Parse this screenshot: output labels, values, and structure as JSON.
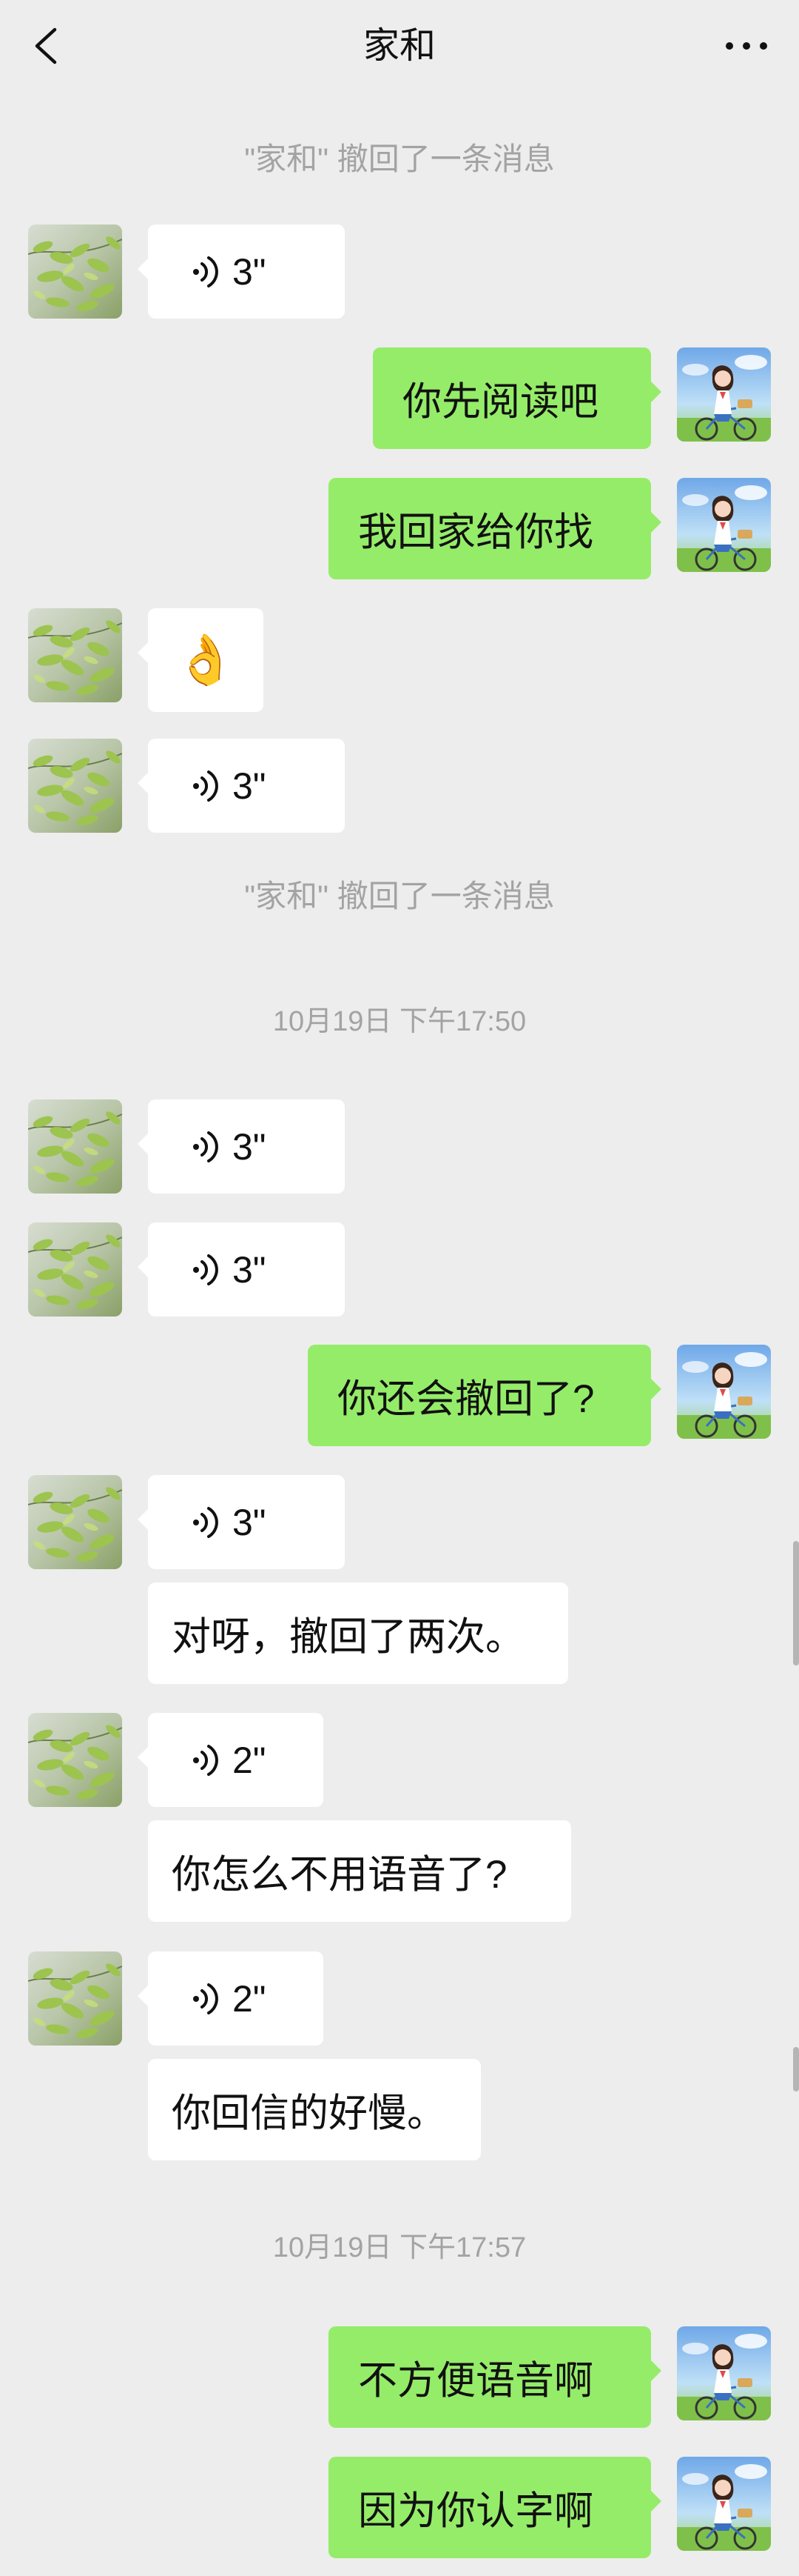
{
  "header": {
    "title": "家和"
  },
  "messages": [
    {
      "type": "system",
      "text": "\"家和\" 撤回了一条消息"
    },
    {
      "type": "voice",
      "from": "them",
      "duration": "3\""
    },
    {
      "type": "text",
      "from": "me",
      "text": "你先阅读吧"
    },
    {
      "type": "text",
      "from": "me",
      "text": "我回家给你找"
    },
    {
      "type": "emoji",
      "from": "them",
      "text": "👌"
    },
    {
      "type": "voice",
      "from": "them",
      "duration": "3\""
    },
    {
      "type": "system",
      "text": "\"家和\" 撤回了一条消息"
    },
    {
      "type": "timestamp",
      "text": "10月19日 下午17:50"
    },
    {
      "type": "voice",
      "from": "them",
      "duration": "3\""
    },
    {
      "type": "voice",
      "from": "them",
      "duration": "3\""
    },
    {
      "type": "text",
      "from": "me",
      "text": "你还会撤回了?"
    },
    {
      "type": "voice",
      "from": "them",
      "duration": "3\""
    },
    {
      "type": "text",
      "from": "them",
      "text": "对呀，撤回了两次。"
    },
    {
      "type": "voice",
      "from": "them",
      "duration": "2\""
    },
    {
      "type": "text",
      "from": "them",
      "text": "你怎么不用语音了?"
    },
    {
      "type": "voice",
      "from": "them",
      "duration": "2\""
    },
    {
      "type": "text",
      "from": "them",
      "text": "你回信的好慢。"
    },
    {
      "type": "timestamp",
      "text": "10月19日 下午17:57"
    },
    {
      "type": "text",
      "from": "me",
      "text": "不方便语音啊"
    },
    {
      "type": "text",
      "from": "me",
      "text": "因为你认字啊"
    }
  ],
  "icons": {
    "back": "chevron-left-icon",
    "more": "more-dots-icon",
    "voice": "voice-wave-icon"
  },
  "colors": {
    "background": "#ededed",
    "outgoing_bubble": "#95ec69",
    "incoming_bubble": "#ffffff",
    "system_text": "#a3a3a3"
  }
}
